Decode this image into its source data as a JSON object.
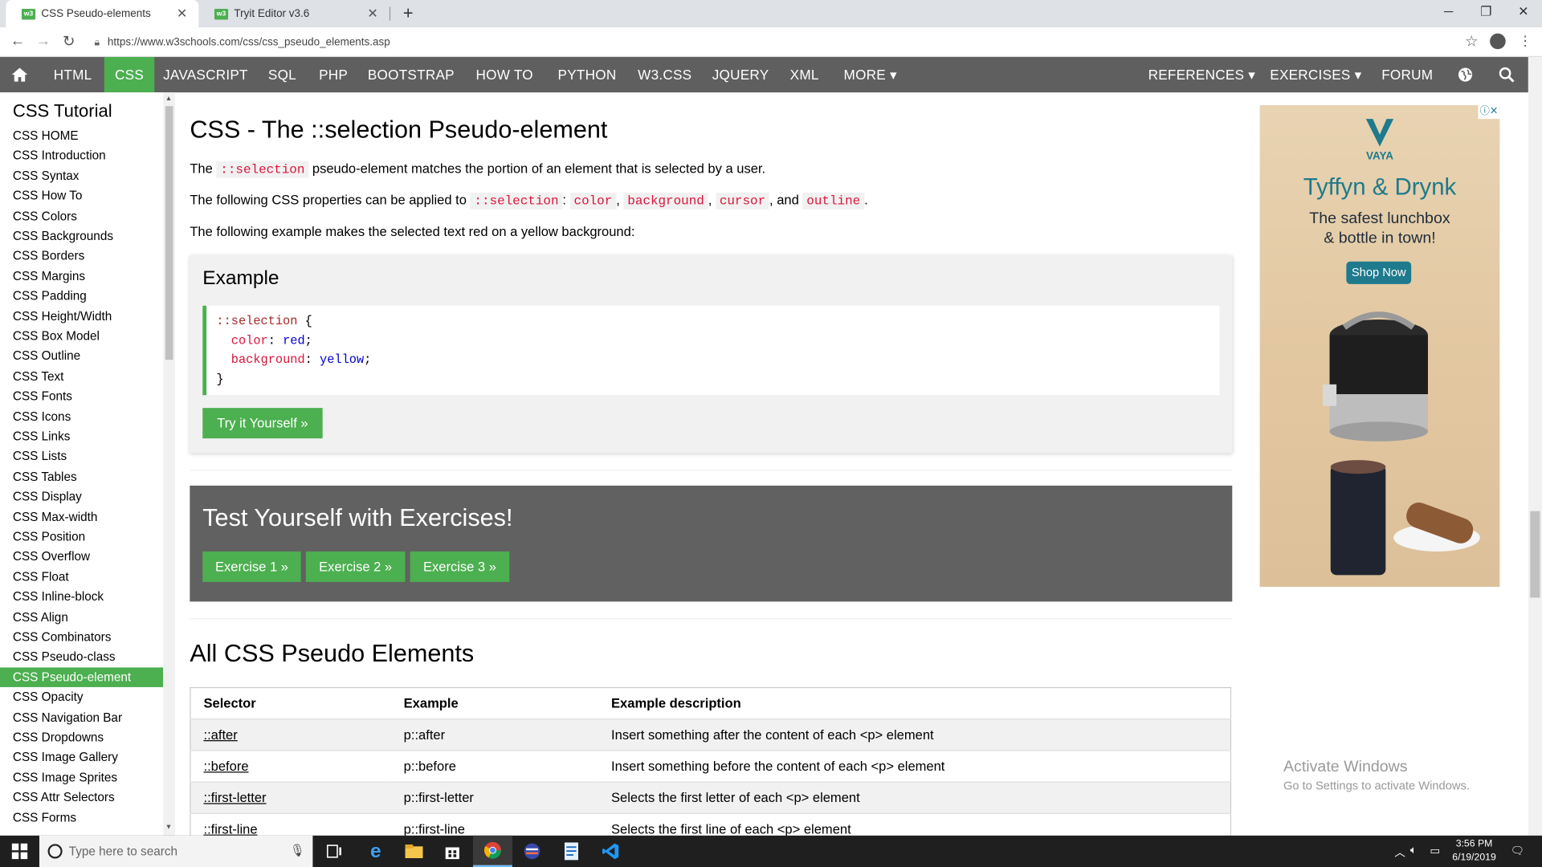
{
  "browser": {
    "tabs": [
      {
        "title": "CSS Pseudo-elements",
        "favicon": "w3"
      },
      {
        "title": "Tryit Editor v3.6",
        "favicon": "w3"
      }
    ],
    "url": "https://www.w3schools.com/css/css_pseudo_elements.asp"
  },
  "topnav": {
    "items": [
      "HTML",
      "CSS",
      "JAVASCRIPT",
      "SQL",
      "PHP",
      "BOOTSTRAP",
      "HOW TO",
      "PYTHON",
      "W3.CSS",
      "JQUERY",
      "XML",
      "MORE ▾"
    ],
    "right_items": [
      "REFERENCES ▾",
      "EXERCISES ▾",
      "FORUM"
    ],
    "active": "CSS"
  },
  "sidebar": {
    "title": "CSS Tutorial",
    "items": [
      "CSS HOME",
      "CSS Introduction",
      "CSS Syntax",
      "CSS How To",
      "CSS Colors",
      "CSS Backgrounds",
      "CSS Borders",
      "CSS Margins",
      "CSS Padding",
      "CSS Height/Width",
      "CSS Box Model",
      "CSS Outline",
      "CSS Text",
      "CSS Fonts",
      "CSS Icons",
      "CSS Links",
      "CSS Lists",
      "CSS Tables",
      "CSS Display",
      "CSS Max-width",
      "CSS Position",
      "CSS Overflow",
      "CSS Float",
      "CSS Inline-block",
      "CSS Align",
      "CSS Combinators",
      "CSS Pseudo-class",
      "CSS Pseudo-element",
      "CSS Opacity",
      "CSS Navigation Bar",
      "CSS Dropdowns",
      "CSS Image Gallery",
      "CSS Image Sprites",
      "CSS Attr Selectors",
      "CSS Forms"
    ],
    "active": "CSS Pseudo-element"
  },
  "main": {
    "title": "CSS - The ::selection Pseudo-element",
    "p1": {
      "pre": "The ",
      "code": "::selection",
      "post": " pseudo-element matches the portion of an element that is selected by a user."
    },
    "p2": {
      "pre": "The following CSS properties can be applied to ",
      "code1": "::selection",
      "colon": ": ",
      "code2": "color",
      "c1": ", ",
      "code3": "background",
      "c2": ", ",
      "code4": "cursor",
      "c3": ", and ",
      "code5": "outline",
      "end": "."
    },
    "p3": "The following example makes the selected text red on a yellow background:",
    "example": {
      "title": "Example",
      "code": {
        "selector": "::selection",
        "open": " {",
        "prop1": "color",
        "val1": "red",
        "prop2": "background",
        "val2": "yellow",
        "close": "}"
      },
      "button": "Try it Yourself »"
    },
    "exercises": {
      "title": "Test Yourself with Exercises!",
      "buttons": [
        "Exercise 1 »",
        "Exercise 2 »",
        "Exercise 3 »"
      ]
    },
    "all_title": "All CSS Pseudo Elements",
    "table": {
      "headers": [
        "Selector",
        "Example",
        "Example description"
      ],
      "rows": [
        [
          "::after",
          "p::after",
          "Insert something after the content of each <p> element"
        ],
        [
          "::before",
          "p::before",
          "Insert something before the content of each <p> element"
        ],
        [
          "::first-letter",
          "p::first-letter",
          "Selects the first letter of each <p> element"
        ],
        [
          "::first-line",
          "p::first-line",
          "Selects the first line of each <p> element"
        ]
      ]
    }
  },
  "ad": {
    "brand": "VAYA",
    "headline": "Tyffyn & Drynk",
    "tagline1": "The safest lunchbox",
    "tagline2": "& bottle in town!",
    "button": "Shop Now",
    "accent": "#1e7a8c"
  },
  "watermark": {
    "line1": "Activate Windows",
    "line2": "Go to Settings to activate Windows."
  },
  "taskbar": {
    "search_placeholder": "Type here to search",
    "time": "3:56 PM",
    "date": "6/19/2019"
  },
  "colors": {
    "w3_green": "#4caf50",
    "nav_bg": "#5f5f5f",
    "code_red": "#dc143c"
  }
}
